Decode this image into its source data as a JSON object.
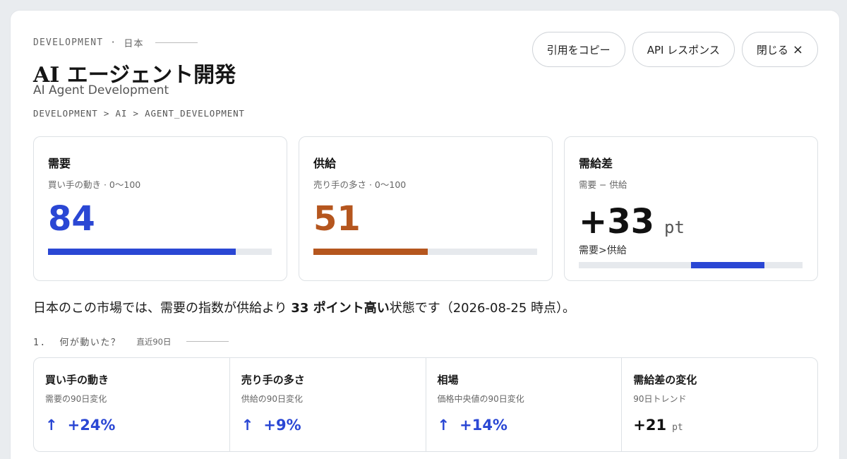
{
  "header": {
    "kicker_category": "DEVELOPMENT",
    "kicker_separator": "·",
    "kicker_region": "日本",
    "title": "AI エージェント開発",
    "subtitle": "AI Agent Development",
    "breadcrumb": "DEVELOPMENT > AI > AGENT_DEVELOPMENT"
  },
  "actions": {
    "copy_citation": "引用をコピー",
    "api_response": "API レスポンス",
    "close_label": "閉じる",
    "close_icon": "×"
  },
  "cards": {
    "demand": {
      "title": "需要",
      "subtitle": "買い手の動き · 0〜100",
      "value": "84",
      "level": 84,
      "color": "#2a47d4"
    },
    "supply": {
      "title": "供給",
      "subtitle": "売り手の多さ · 0〜100",
      "value": "51",
      "level": 51,
      "color": "#b5561e"
    },
    "gap": {
      "title": "需給差",
      "subtitle": "需要 − 供給",
      "value": "+33",
      "unit": "pt",
      "note": "需要>供給",
      "level": 33,
      "color": "#2a47d4"
    }
  },
  "summary": {
    "prefix": "日本のこの市場では、需要の指数が供給より ",
    "emphasis": "33 ポイント高い",
    "suffix": "状態です（2026-08-25 時点）。"
  },
  "section": {
    "number": "1.",
    "title": "何が動いた？",
    "period": "直近90日"
  },
  "metrics": [
    {
      "title": "買い手の動き",
      "subtitle": "需要の90日変化",
      "arrow": "↑",
      "value": "+24%",
      "unit": "",
      "color": "#2a47d4"
    },
    {
      "title": "売り手の多さ",
      "subtitle": "供給の90日変化",
      "arrow": "↑",
      "value": "+9%",
      "unit": "",
      "color": "#2a47d4"
    },
    {
      "title": "相場",
      "subtitle": "価格中央値の90日変化",
      "arrow": "↑",
      "value": "+14%",
      "unit": "",
      "color": "#2a47d4"
    },
    {
      "title": "需給差の変化",
      "subtitle": "90日トレンド",
      "arrow": "",
      "value": "+21",
      "unit": "pt",
      "color": "#111111"
    }
  ]
}
